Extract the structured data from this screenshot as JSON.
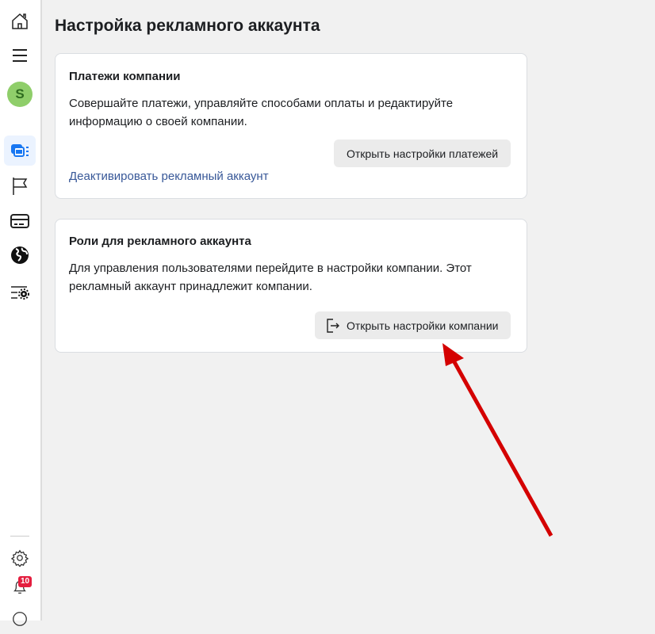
{
  "sidebar": {
    "avatar_letter": "S",
    "notification_count": "10"
  },
  "page": {
    "title": "Настройка рекламного аккаунта"
  },
  "payments": {
    "title": "Платежи компании",
    "description": "Совершайте платежи, управляйте способами оплаты и редактируйте информацию о своей компании.",
    "button": "Открыть настройки платежей",
    "deactivate_link": "Деактивировать рекламный аккаунт"
  },
  "roles": {
    "title": "Роли для рекламного аккаунта",
    "description": "Для управления пользователями перейдите в настройки компании. Этот рекламный аккаунт принадлежит компании.",
    "button": "Открыть настройки компании"
  },
  "colors": {
    "accent": "#1877f2",
    "arrow": "#d40000",
    "badge": "#e41e3f"
  }
}
